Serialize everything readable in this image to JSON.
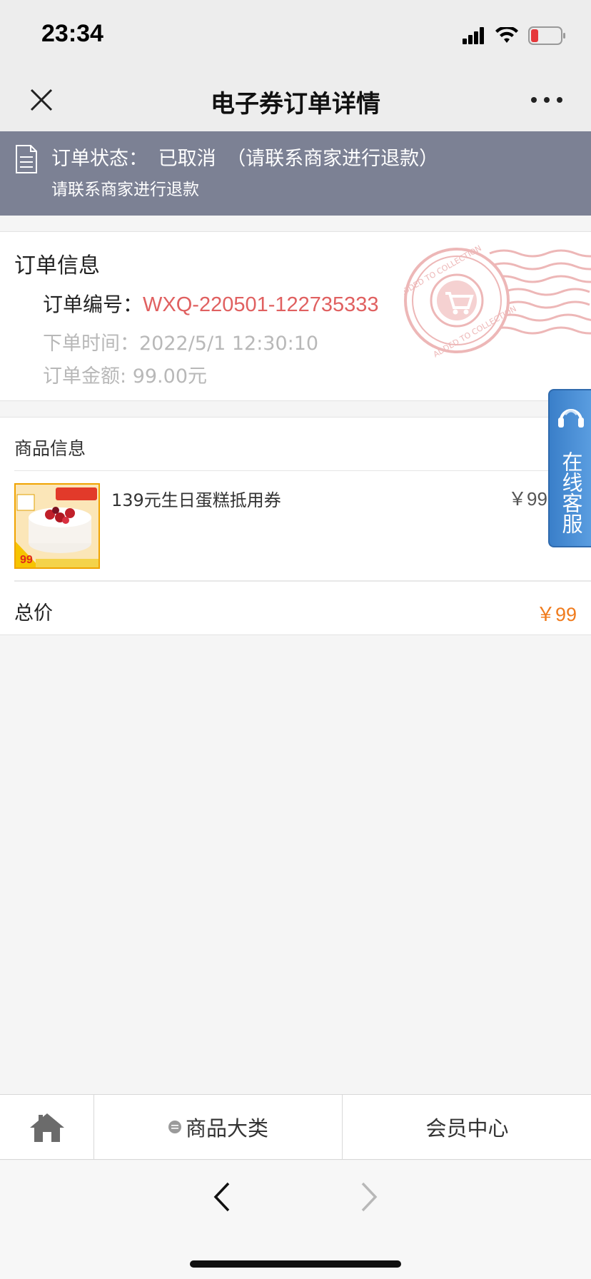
{
  "status_bar": {
    "time": "23:34",
    "icons": [
      "signal-icon",
      "wifi-icon",
      "battery-icon"
    ],
    "battery_color": "#e5383b"
  },
  "nav": {
    "title": "电子券订单详情",
    "close_icon": "close-icon",
    "more_icon": "more-icon"
  },
  "status_banner": {
    "status_label": "订单状态：",
    "status_value": "已取消",
    "status_note": "（请联系商家进行退款）",
    "sub_text": "请联系商家进行退款",
    "background": "#7c8194"
  },
  "order_info": {
    "title": "订单信息",
    "order_no_label": "订单编号：",
    "order_no_value": "WXQ-220501-122735333",
    "order_time_label": "下单时间：",
    "order_time_value": "2022/5/1 12:30:10",
    "amount_label": "订单金额:",
    "amount_value": "99.00元",
    "stamp_icon": "added-to-collection-stamp"
  },
  "goods": {
    "header": "商品信息",
    "items": [
      {
        "name": "139元生日蛋糕抵用券",
        "price": "￥99",
        "thumb_icon": "cake-thumbnail"
      }
    ],
    "total_label": "总价",
    "total_value": "￥99",
    "total_color": "#f07c1e"
  },
  "customer_service": {
    "label": "在线客服",
    "icon": "headset-icon"
  },
  "tab_bar": {
    "home_icon": "home-icon",
    "category_label": "商品大类",
    "member_label": "会员中心"
  },
  "browser": {
    "back_icon": "back-icon",
    "forward_icon": "forward-icon"
  }
}
